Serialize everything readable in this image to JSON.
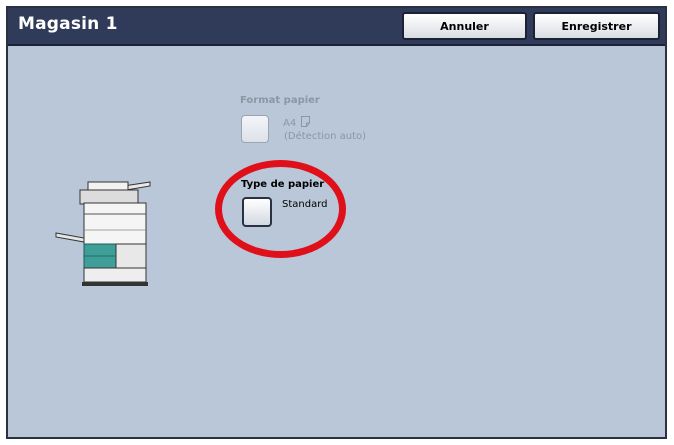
{
  "header": {
    "title": "Magasin 1",
    "cancel_label": "Annuler",
    "save_label": "Enregistrer"
  },
  "paper_size": {
    "label": "Format papier",
    "value": "A4",
    "detail": "(Détection auto)",
    "state": "disabled"
  },
  "paper_type": {
    "label": "Type de papier",
    "value": "Standard",
    "highlighted": true
  },
  "colors": {
    "title_bar": "#2f3b58",
    "panel_background": "#b9c7d8",
    "highlight": "#e0101a"
  },
  "icons": [
    "printer-illustration",
    "portrait-page-icon"
  ]
}
